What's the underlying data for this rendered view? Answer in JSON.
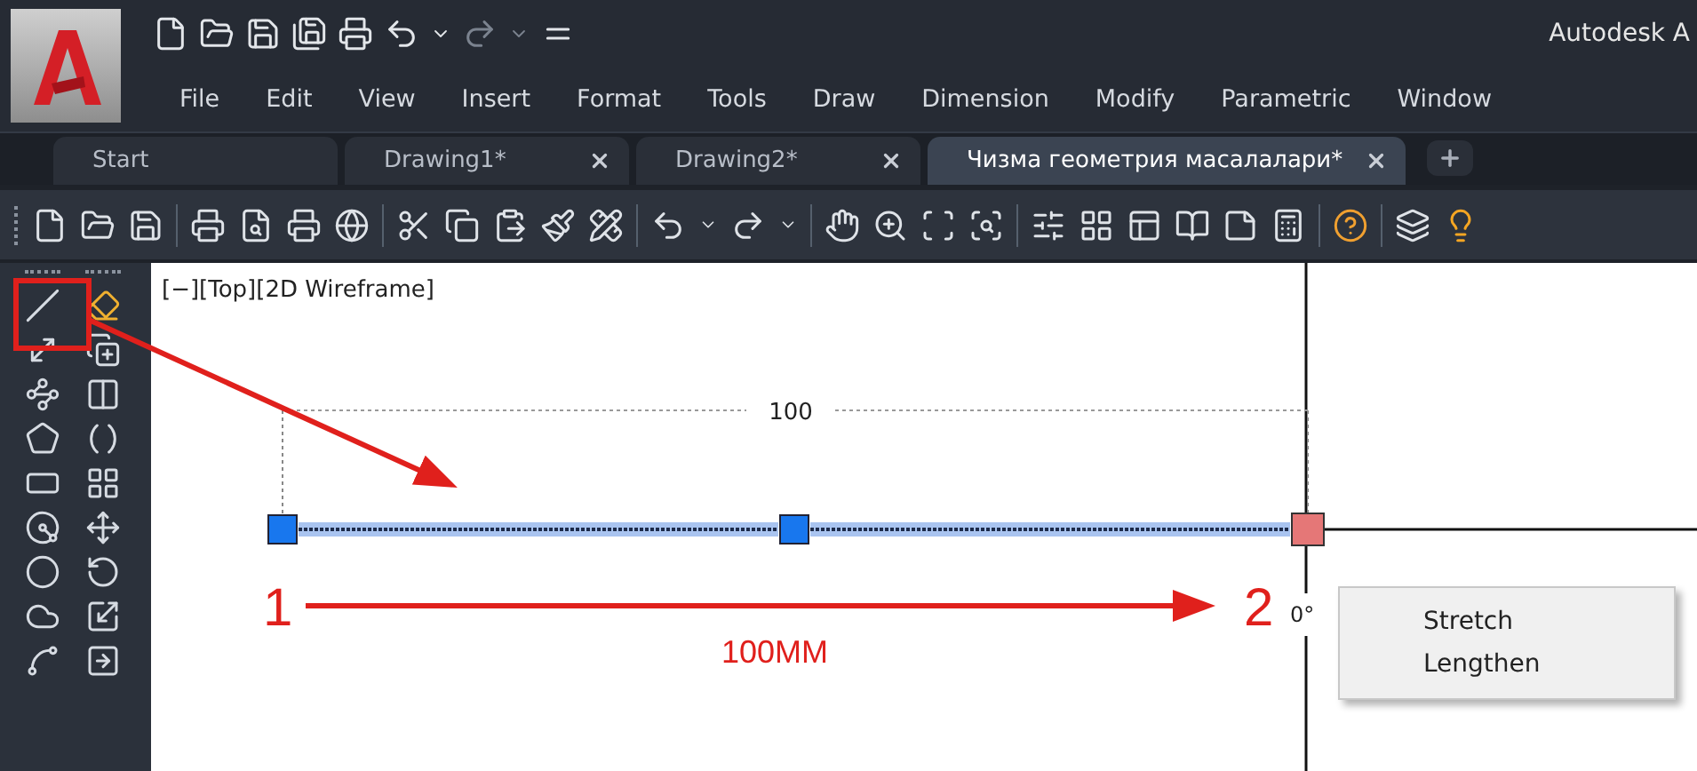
{
  "window": {
    "title": "Autodesk A"
  },
  "menu": [
    "File",
    "Edit",
    "View",
    "Insert",
    "Format",
    "Tools",
    "Draw",
    "Dimension",
    "Modify",
    "Parametric",
    "Window"
  ],
  "tabs": [
    {
      "label": "Start",
      "selected": false,
      "closable": false
    },
    {
      "label": "Drawing1*",
      "selected": false,
      "closable": true
    },
    {
      "label": "Drawing2*",
      "selected": false,
      "closable": true
    },
    {
      "label": "Чизма геометрия масалалари*",
      "selected": true,
      "closable": true
    }
  ],
  "viewport": {
    "label": "[−][Top][2D Wireframe]",
    "dimension": "100",
    "angle": "0°"
  },
  "annotations": {
    "start": "1",
    "end": "2",
    "length": "100MM"
  },
  "context_menu": [
    "Stretch",
    "Lengthen"
  ]
}
